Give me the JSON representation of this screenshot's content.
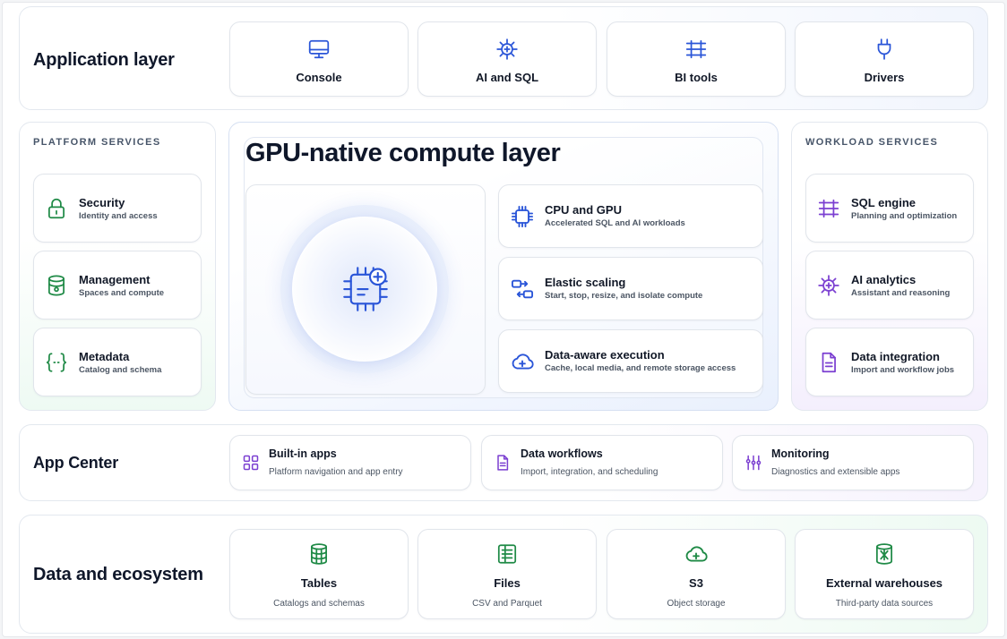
{
  "colors": {
    "blue": "#2a55d8",
    "green": "#1f8a46",
    "purple": "#7b3fd1",
    "dark": "#0f172a"
  },
  "application_layer": {
    "title": "Application layer",
    "items": [
      {
        "label": "Console",
        "icon": "monitor-icon"
      },
      {
        "label": "AI and SQL",
        "icon": "sparkle-chip-icon"
      },
      {
        "label": "BI tools",
        "icon": "grid-icon"
      },
      {
        "label": "Drivers",
        "icon": "plug-icon"
      }
    ]
  },
  "platform_services": {
    "title": "PLATFORM SERVICES",
    "items": [
      {
        "title": "Security",
        "subtitle": "Identity and access",
        "icon": "lock-icon"
      },
      {
        "title": "Management",
        "subtitle": "Spaces and compute",
        "icon": "database-gear-icon"
      },
      {
        "title": "Metadata",
        "subtitle": "Catalog and schema",
        "icon": "braces-icon"
      }
    ]
  },
  "compute_layer": {
    "title": "GPU-native compute layer",
    "hero_icon": "gpu-chip-icon",
    "items": [
      {
        "title": "CPU and GPU",
        "subtitle": "Accelerated SQL and AI workloads",
        "icon": "chip-icon"
      },
      {
        "title": "Elastic scaling",
        "subtitle": "Start, stop, resize, and isolate compute",
        "icon": "scaling-icon"
      },
      {
        "title": "Data-aware execution",
        "subtitle": "Cache, local media, and remote storage access",
        "icon": "cloud-plus-icon"
      }
    ]
  },
  "workload_services": {
    "title": "WORKLOAD SERVICES",
    "items": [
      {
        "title": "SQL engine",
        "subtitle": "Planning and optimization",
        "icon": "grid-icon"
      },
      {
        "title": "AI analytics",
        "subtitle": "Assistant and reasoning",
        "icon": "sparkle-chip-icon"
      },
      {
        "title": "Data integration",
        "subtitle": "Import and workflow jobs",
        "icon": "document-icon"
      }
    ]
  },
  "app_center": {
    "title": "App Center",
    "items": [
      {
        "title": "Built-in apps",
        "subtitle": "Platform navigation and app entry",
        "icon": "apps-grid-icon"
      },
      {
        "title": "Data workflows",
        "subtitle": "Import, integration, and scheduling",
        "icon": "document-icon"
      },
      {
        "title": "Monitoring",
        "subtitle": "Diagnostics and extensible apps",
        "icon": "sliders-icon"
      }
    ]
  },
  "data_ecosystem": {
    "title": "Data and ecosystem",
    "items": [
      {
        "title": "Tables",
        "subtitle": "Catalogs and schemas",
        "icon": "database-icon"
      },
      {
        "title": "Files",
        "subtitle": "CSV and Parquet",
        "icon": "file-list-icon"
      },
      {
        "title": "S3",
        "subtitle": "Object storage",
        "icon": "cloud-plus-icon"
      },
      {
        "title": "External warehouses",
        "subtitle": "Third-party data sources",
        "icon": "database-link-icon"
      }
    ]
  }
}
